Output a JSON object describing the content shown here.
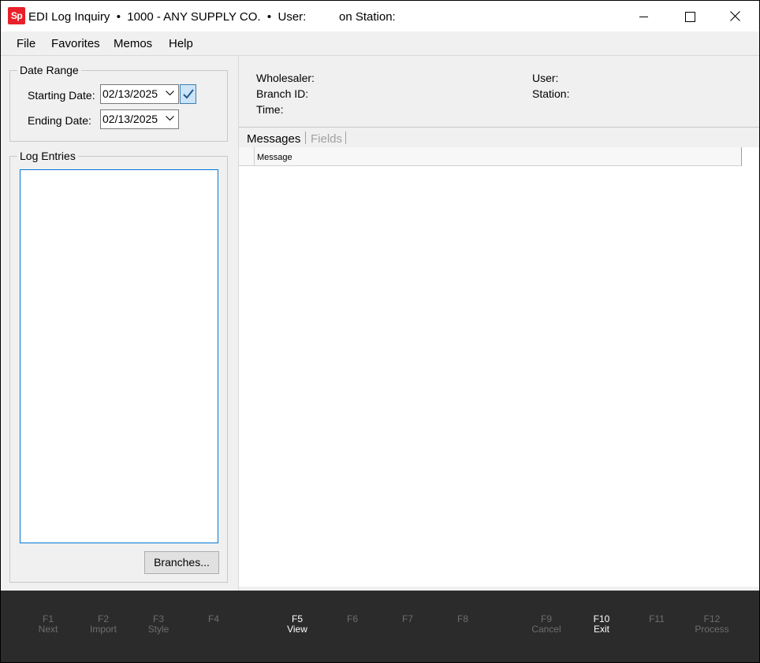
{
  "titlebar": {
    "logo": "Sp",
    "title": "EDI Log Inquiry  •  1000 - ANY SUPPLY CO.  •  User:          on Station:",
    "icons": {
      "minimize": "minimize-icon",
      "maximize": "maximize-icon",
      "close": "close-icon"
    }
  },
  "menu": {
    "file": "File",
    "favorites": "Favorites",
    "memos": "Memos",
    "help": "Help"
  },
  "date_range": {
    "legend": "Date Range",
    "starting_label": "Starting Date:",
    "starting_value": "02/13/2025",
    "ending_label": "Ending Date:",
    "ending_value": "02/13/2025"
  },
  "log_entries": {
    "legend": "Log Entries",
    "branches_button": "Branches..."
  },
  "info": {
    "wholesaler": "Wholesaler:",
    "branch_id": "Branch ID:",
    "time": "Time:",
    "user": "User:",
    "station": "Station:"
  },
  "tabs": {
    "messages": "Messages",
    "fields": "Fields"
  },
  "grid": {
    "columns": [
      "Message"
    ]
  },
  "fkeys": [
    {
      "key": "F1",
      "label": "Next",
      "enabled": false
    },
    {
      "key": "F2",
      "label": "Import",
      "enabled": false
    },
    {
      "key": "F3",
      "label": "Style",
      "enabled": false
    },
    {
      "key": "F4",
      "label": "",
      "enabled": false
    },
    {
      "key": "F5",
      "label": "View",
      "enabled": true
    },
    {
      "key": "F6",
      "label": "",
      "enabled": false
    },
    {
      "key": "F7",
      "label": "",
      "enabled": false
    },
    {
      "key": "F8",
      "label": "",
      "enabled": false
    },
    {
      "key": "F9",
      "label": "Cancel",
      "enabled": false
    },
    {
      "key": "F10",
      "label": "Exit",
      "enabled": true
    },
    {
      "key": "F11",
      "label": "",
      "enabled": false
    },
    {
      "key": "F12",
      "label": "Process",
      "enabled": false
    }
  ],
  "colors": {
    "logo": "#e8202a",
    "fkey_bar": "#2b2b2b",
    "fkey_enabled": "#ffffff",
    "fkey_disabled": "#6e6e6e",
    "focus_border": "#0078d7"
  }
}
